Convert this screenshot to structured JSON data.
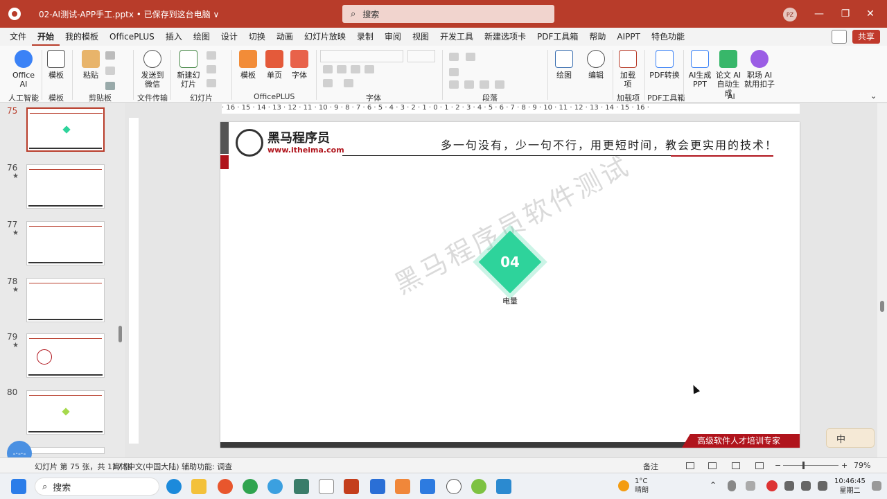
{
  "window": {
    "title": "02-AI测试-APP手工.pptx • 已保存到这台电脑 ∨",
    "search_placeholder": "搜索",
    "avatar_initials": "PZ",
    "minimize": "—",
    "restore": "❐",
    "close": "✕"
  },
  "menu": {
    "items": [
      "文件",
      "开始",
      "我的模板",
      "OfficePLUS",
      "插入",
      "绘图",
      "设计",
      "切换",
      "动画",
      "幻灯片放映",
      "录制",
      "审阅",
      "视图",
      "开发工具",
      "新建选项卡",
      "PDF工具箱",
      "帮助",
      "AIPPT",
      "特色功能"
    ],
    "active": "开始",
    "share": "共享"
  },
  "ribbon": {
    "office_ai": "Office AI",
    "ai_group": "人工智能",
    "template": "模板",
    "template_group": "模板",
    "paste": "粘贴",
    "clipboard_group": "剪贴板",
    "send_wechat": "发送到微信",
    "file_transfer_group": "文件传输",
    "new_slide": "新建幻灯片",
    "slides_group": "幻灯片",
    "officeplus_template": "模板",
    "single_page": "单页",
    "font_btn": "字体",
    "officeplus_group": "OfficePLUS",
    "font_group": "字体",
    "paragraph_group": "段落",
    "draw": "绘图",
    "edit": "编辑",
    "addins": "加载项",
    "addins_group": "加载项",
    "pdf_convert": "PDF转换",
    "pdf_group": "PDF工具箱",
    "ai_ppt": "AI生成PPT",
    "essay_ai": "论文 AI 自动生成",
    "job_ai": "职场 AI 就用扣子",
    "ai_group2": "AI"
  },
  "thumbnails": [
    {
      "num": "75",
      "star": "",
      "selected": true
    },
    {
      "num": "76",
      "star": "★",
      "selected": false
    },
    {
      "num": "77",
      "star": "★",
      "selected": false
    },
    {
      "num": "78",
      "star": "★",
      "selected": false
    },
    {
      "num": "79",
      "star": "★",
      "selected": false
    },
    {
      "num": "80",
      "star": "",
      "selected": false
    }
  ],
  "ruler": {
    "horizontal": "· 16 · 15 · 14 · 13 · 12 · 11 · 10 · 9 · 8 · 7 · 6 · 5 · 4 · 3 · 2 · 1 · 0 · 1 · 2 · 3 · 4 · 5 · 6 · 7 · 8 · 9 · 10 · 11 · 12 · 13 · 14 · 15 · 16 ·"
  },
  "slide": {
    "brand_name": "黑马程序员",
    "brand_url": "www.itheima.com",
    "slogan": "多一句没有，少一句不行，用更短时间，教会更实用的技术！",
    "badge_number": "04",
    "badge_label": "电量",
    "watermark": "黑马程序员软件测试",
    "footer": "高级软件人才培训专家"
  },
  "ime": {
    "mode": "中"
  },
  "status": {
    "slide_info": "幻灯片 第 75 张，共 117 张",
    "language": "简体中文(中国大陆)",
    "accessibility": "辅助功能: 调查",
    "notes": "备注",
    "zoom": "79%"
  },
  "taskbar": {
    "search": "搜索",
    "temperature": "1°C",
    "weather_text": "晴朗",
    "time": "10:46:45",
    "weekday": "星期二"
  },
  "floating": {
    "label": "-·-·-"
  },
  "colors": {
    "accent": "#b83c2a",
    "badge": "#2ed39b",
    "brand_red": "#b0141c"
  }
}
